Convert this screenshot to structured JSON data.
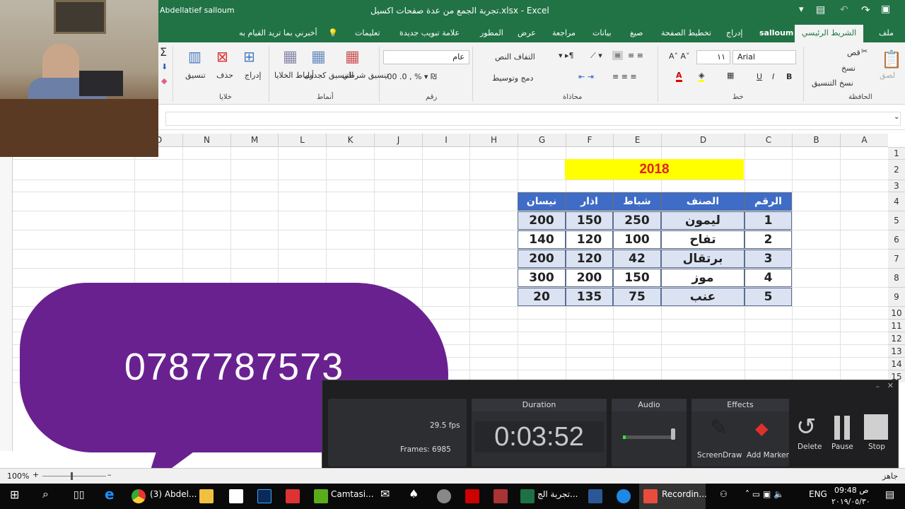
{
  "titlebar": {
    "user": "Abdellatief salloum",
    "title": "تجربة الجمع من عدة صفحات اكسيل.xlsx - Excel"
  },
  "tabs": [
    "ملف",
    "الشريط الرئيسي",
    "salloum",
    "إدراج",
    "تخطيط الصفحة",
    "صيغ",
    "بيانات",
    "مراجعة",
    "عرض",
    "المطور",
    "علامة تبويب جديدة",
    "تعليمات"
  ],
  "tell_me": "أخبرني بما تريد القيام به",
  "ribbon": {
    "clipboard": {
      "paste": "لصق",
      "cut": "قص",
      "copy": "نسخ",
      "format_painter": "نسخ التنسيق",
      "group": "الحافظة"
    },
    "font": {
      "name": "Arial",
      "size": "١١",
      "bold": "B",
      "italic": "I",
      "underline": "U",
      "group": "خط"
    },
    "alignment": {
      "wrap": "التفاف النص",
      "merge": "دمج وتوسيط",
      "group": "محاذاة"
    },
    "number": {
      "format": "عام",
      "group": "رقم"
    },
    "styles": {
      "conditional": "تنسيق شرطي",
      "as_table": "التنسيق كجدول",
      "cell_styles": "أنماط الخلايا",
      "group": "أنماط"
    },
    "cells": {
      "insert": "إدراج",
      "delete": "حذف",
      "format": "تنسيق",
      "group": "خلايا"
    }
  },
  "columns": [
    "A",
    "B",
    "C",
    "D",
    "E",
    "F",
    "G",
    "H",
    "I",
    "J",
    "K",
    "L",
    "M",
    "N",
    "O"
  ],
  "rows": [
    "1",
    "2",
    "3",
    "4",
    "5",
    "6",
    "7",
    "8",
    "9",
    "10",
    "11",
    "12",
    "13",
    "14",
    "15"
  ],
  "sheet": {
    "year": "2018",
    "headers": [
      "الرقم",
      "الصنف",
      "شباط",
      "اذار",
      "نيسان"
    ],
    "data": [
      [
        "1",
        "ليمون",
        "250",
        "150",
        "200"
      ],
      [
        "2",
        "تفاح",
        "100",
        "120",
        "140"
      ],
      [
        "3",
        "برتقال",
        "42",
        "120",
        "200"
      ],
      [
        "4",
        "موز",
        "150",
        "200",
        "300"
      ],
      [
        "5",
        "عنب",
        "75",
        "135",
        "20"
      ]
    ]
  },
  "overlay": {
    "phone": "0787787573"
  },
  "recorder": {
    "fps": "29.5 fps",
    "frames": "Frames: 6985",
    "duration_title": "Duration",
    "duration": "0:03:52",
    "audio_title": "Audio",
    "effects_title": "Effects",
    "screendraw": "ScreenDraw",
    "add_marker": "Add Marker",
    "delete": "Delete",
    "pause": "Pause",
    "stop": "Stop",
    "audio_level": 0.05
  },
  "status": {
    "ready": "جاهز",
    "zoom": "100%"
  },
  "taskbar": {
    "chrome": "(3) Abdel...",
    "camtasia": "Camtasi...",
    "excel": "تجربة الج...",
    "recording": "Recordin...",
    "lang": "ENG",
    "time": "09:48 ص",
    "date": "٢٠١٩/٠٥/٣٠"
  }
}
